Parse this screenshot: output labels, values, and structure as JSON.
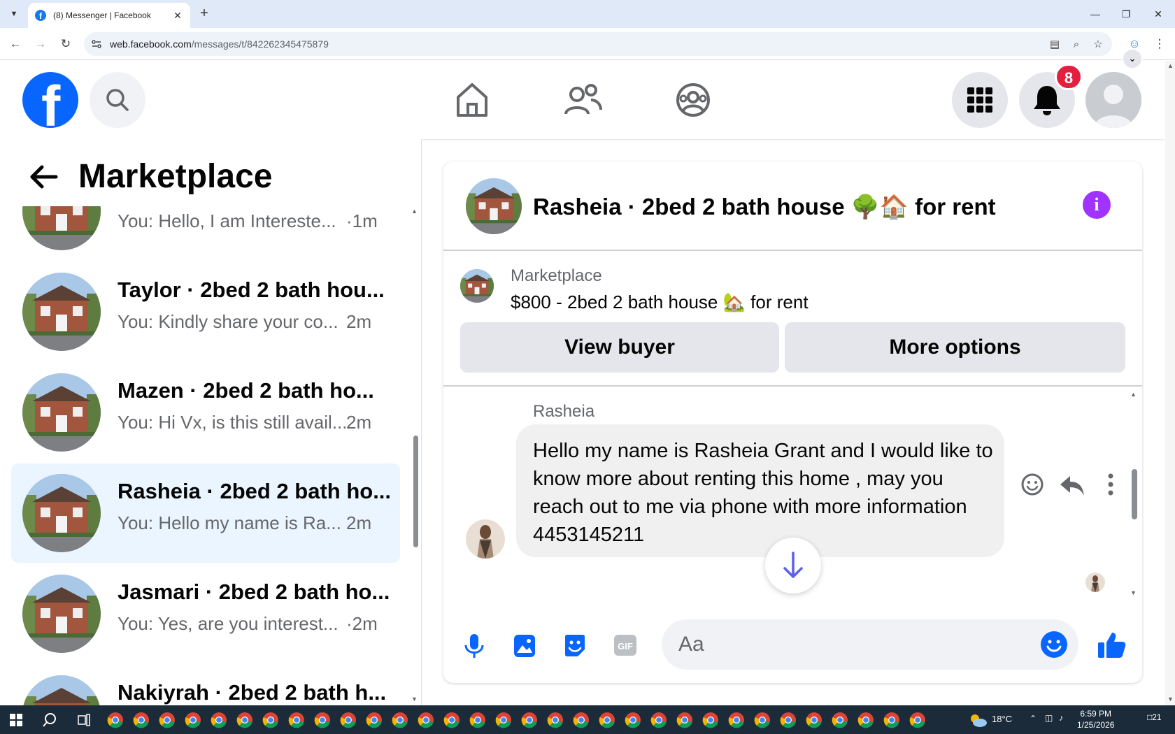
{
  "browser": {
    "tab_title": "(8) Messenger | Facebook",
    "url_host": "web.facebook.com",
    "url_path": "/messages/t/842262345475879"
  },
  "header": {
    "notification_count": "8",
    "brand_color": "#0866ff"
  },
  "left_panel": {
    "title": "Marketplace",
    "conversations": [
      {
        "name": "",
        "preview": "You: Hello, I am Intereste...",
        "time": "·1m",
        "active": false
      },
      {
        "name": "Taylor · 2bed 2 bath hou...",
        "preview": "You: Kindly share your co...",
        "time": "2m",
        "active": false
      },
      {
        "name": "Mazen · 2bed 2 bath ho...",
        "preview": "You: Hi Vx, is this still avail...",
        "time": "2m",
        "active": false
      },
      {
        "name": "Rasheia · 2bed 2 bath ho...",
        "preview": "You: Hello my name is Ra...",
        "time": "2m",
        "active": true
      },
      {
        "name": "Jasmari · 2bed 2 bath ho...",
        "preview": "You: Yes, are you interest...",
        "time": "·2m",
        "active": false
      },
      {
        "name": "Nakiyrah · 2bed 2 bath h...",
        "preview": "",
        "time": "",
        "active": false
      }
    ]
  },
  "chat": {
    "title": "Rasheia · 2bed 2 bath house 🌳🏠 for rent",
    "listing": {
      "source": "Marketplace",
      "price_line": "$800 - 2bed 2 bath house 🏡 for rent",
      "view_buyer_label": "View buyer",
      "more_options_label": "More options"
    },
    "message": {
      "sender": "Rasheia",
      "text": "Hello my name is Rasheia Grant and I would like to know more about renting this home , may you reach out to me via phone with more information 4453145211"
    },
    "composer": {
      "placeholder": "Aa"
    },
    "accent_color": "#a033ff"
  },
  "taskbar": {
    "temperature": "18°C",
    "time": "6:59 PM",
    "date": "1/25/2026",
    "notifications": "21"
  }
}
